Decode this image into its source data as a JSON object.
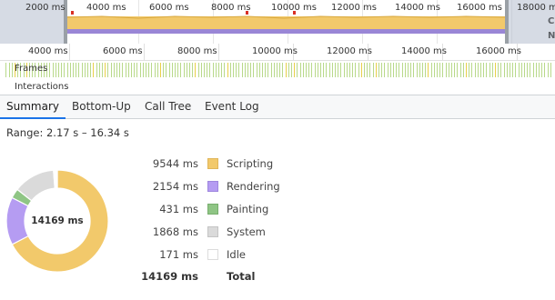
{
  "overview": {
    "ticks": [
      "2000 ms",
      "4000 ms",
      "6000 ms",
      "8000 ms",
      "10000 ms",
      "12000 ms",
      "14000 ms",
      "16000 ms",
      "18000 ms"
    ],
    "side_labels": [
      "C",
      "N"
    ]
  },
  "ruler": {
    "ticks": [
      "4000 ms",
      "6000 ms",
      "8000 ms",
      "10000 ms",
      "12000 ms",
      "14000 ms",
      "16000 ms"
    ]
  },
  "tracks": {
    "frames_label": "Frames",
    "interactions_label": "Interactions"
  },
  "tabs": [
    {
      "label": "Summary",
      "active": true
    },
    {
      "label": "Bottom-Up",
      "active": false
    },
    {
      "label": "Call Tree",
      "active": false
    },
    {
      "label": "Event Log",
      "active": false
    }
  ],
  "summary": {
    "range": "Range: 2.17 s – 16.34 s",
    "total_center": "14169 ms",
    "items": [
      {
        "ms": "9544 ms",
        "name": "Scripting",
        "value": 9544,
        "color": "#f2c96b",
        "border": "#e0b55a"
      },
      {
        "ms": "2154 ms",
        "name": "Rendering",
        "value": 2154,
        "color": "#b59cf2",
        "border": "#9e86de"
      },
      {
        "ms": "431 ms",
        "name": "Painting",
        "value": 431,
        "color": "#8fc585",
        "border": "#78ae6e"
      },
      {
        "ms": "1868 ms",
        "name": "System",
        "value": 1868,
        "color": "#dadada",
        "border": "#c4c4c4"
      },
      {
        "ms": "171 ms",
        "name": "Idle",
        "value": 171,
        "color": "#ffffff",
        "border": "#dcdcdc"
      }
    ],
    "total_ms": "14169 ms",
    "total_label": "Total"
  }
}
